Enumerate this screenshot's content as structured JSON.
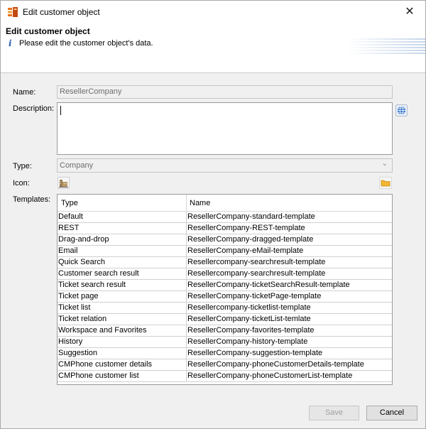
{
  "window": {
    "title": "Edit customer object",
    "close_glyph": "✕"
  },
  "header": {
    "title": "Edit customer object",
    "description": "Please edit the customer object's data.",
    "info_glyph": "i"
  },
  "form": {
    "name_label": "Name:",
    "name_value": "ResellerCompany",
    "description_label": "Description:",
    "description_value": "",
    "type_label": "Type:",
    "type_value": "Company",
    "icon_label": "Icon:",
    "templates_label": "Templates:"
  },
  "templates": {
    "columns": [
      "Type",
      "Name"
    ],
    "rows": [
      [
        "Default",
        "ResellerCompany-standard-template"
      ],
      [
        "REST",
        "ResellerCompany-REST-template"
      ],
      [
        "Drag-and-drop",
        "ResellerCompany-dragged-template"
      ],
      [
        "Email",
        "ResellerCompany-eMail-template"
      ],
      [
        "Quick Search",
        "Resellercompany-searchresult-template"
      ],
      [
        "Customer search result",
        "Resellercompany-searchresult-template"
      ],
      [
        "Ticket search result",
        "ResellerCompany-ticketSearchResult-template"
      ],
      [
        "Ticket page",
        "ResellerCompany-ticketPage-template"
      ],
      [
        "Ticket list",
        "Resellercompany-ticketlist-template"
      ],
      [
        "Ticket relation",
        "ResellerCompany-ticketList-temlate"
      ],
      [
        "Workspace and Favorites",
        "ResellerCompany-favorites-template"
      ],
      [
        "History",
        "ResellerCompany-history-template"
      ],
      [
        "Suggestion",
        "ResellerCompany-suggestion-template"
      ],
      [
        "CMPhone customer details",
        "ResellerCompany-phoneCustomerDetails-template"
      ],
      [
        "CMPhone customer list",
        "ResellerCompany-phoneCustomerList-template"
      ]
    ]
  },
  "buttons": {
    "save": "Save",
    "cancel": "Cancel"
  },
  "colors": {
    "accent": "#2a5db0",
    "app_icon_orange": "#e8731a",
    "folder": "#f2b632"
  }
}
